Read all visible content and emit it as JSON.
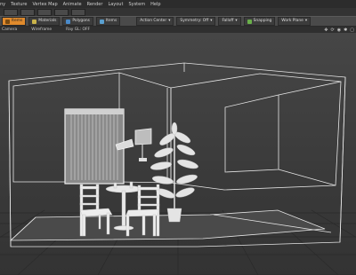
{
  "menu": [
    "ny",
    "Texture",
    "Vertex Map",
    "Animate",
    "Render",
    "Layout",
    "System",
    "Help"
  ],
  "tabs": [
    "",
    "",
    "",
    "",
    ""
  ],
  "toolbar": {
    "buttons": [
      {
        "label": "Items",
        "active": true,
        "icon": "items-icon"
      },
      {
        "label": "Materials",
        "active": false,
        "icon": "materials-icon"
      },
      {
        "label": "Polygons",
        "active": false,
        "icon": "polygons-icon"
      },
      {
        "label": "Items",
        "active": false,
        "icon": "items-icon"
      }
    ],
    "action_center": "Action Center",
    "symmetry": "Symmetry: Off",
    "falloff": "Falloff",
    "snapping": "Snapping",
    "work_plane": "Work Plane"
  },
  "viewport_header": {
    "view": "Camera",
    "shading": "Wireframe",
    "ray_gl": "Ray GL: OFF"
  },
  "colors": {
    "accent": "#e08a2c",
    "wire": "#e6e6e6",
    "grid": "#2b2b2b"
  }
}
